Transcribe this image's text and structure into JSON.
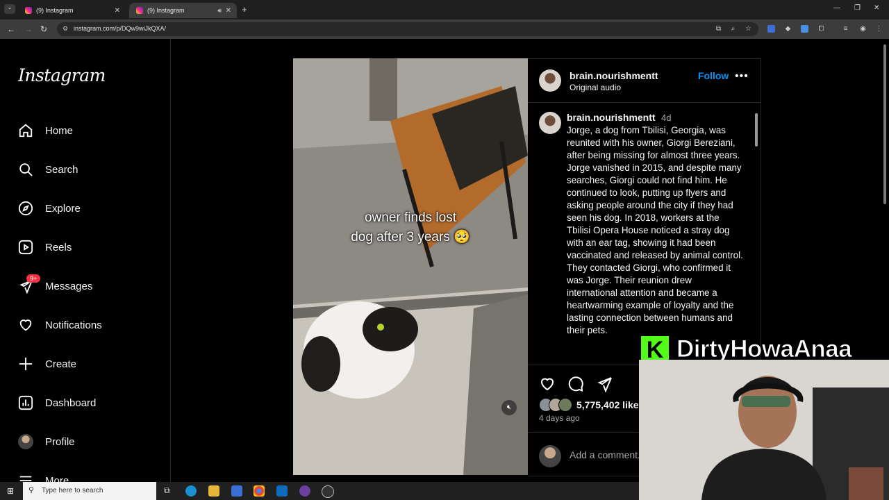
{
  "browser": {
    "tabs": [
      {
        "title": "(9) Instagram"
      },
      {
        "title": "(9) Instagram"
      }
    ],
    "url": "instagram.com/p/DQw9wiJkQXA/"
  },
  "sidebar": {
    "logo": "Instagram",
    "items": [
      {
        "label": "Home",
        "icon": "home-icon"
      },
      {
        "label": "Search",
        "icon": "search-icon"
      },
      {
        "label": "Explore",
        "icon": "compass-icon"
      },
      {
        "label": "Reels",
        "icon": "reels-icon"
      },
      {
        "label": "Messages",
        "icon": "messenger-icon",
        "badge": "9+"
      },
      {
        "label": "Notifications",
        "icon": "heart-icon"
      },
      {
        "label": "Create",
        "icon": "plus-icon"
      },
      {
        "label": "Dashboard",
        "icon": "dashboard-icon"
      },
      {
        "label": "Profile",
        "icon": "avatar"
      },
      {
        "label": "More",
        "icon": "menu-icon"
      }
    ]
  },
  "post": {
    "video_caption_line1": "owner finds lost",
    "video_caption_line2": "dog after 3 years 🥺",
    "header": {
      "username": "brain.nourishmentt",
      "audio": "Original audio",
      "follow_label": "Follow",
      "more_label": "•••"
    },
    "caption": {
      "username": "brain.nourishmentt",
      "age": "4d",
      "text": "Jorge, a dog from Tbilisi, Georgia, was reunited with his owner, Giorgi Bereziani, after being missing for almost three years. Jorge vanished in 2015, and despite many searches, Giorgi could not find him. He continued to look, putting up flyers and asking people around the city if they had seen his dog. In 2018, workers at the Tbilisi Opera House noticed a stray dog with an ear tag, showing it had been vaccinated and released by animal control. They contacted Giorgi, who confirmed it was Jorge. Their reunion drew international attention and became a heartwarming example of loyalty and the lasting connection between humans and their pets."
    },
    "likes": "5,775,402 likes",
    "posted": "4 days ago",
    "comment_placeholder": "Add a comment..."
  },
  "stream_overlay": {
    "channel_name": "DirtyHowaAnaa",
    "logo_letter": "K",
    "accent": "#53fc18"
  },
  "taskbar": {
    "search_placeholder": "Type here to search"
  }
}
